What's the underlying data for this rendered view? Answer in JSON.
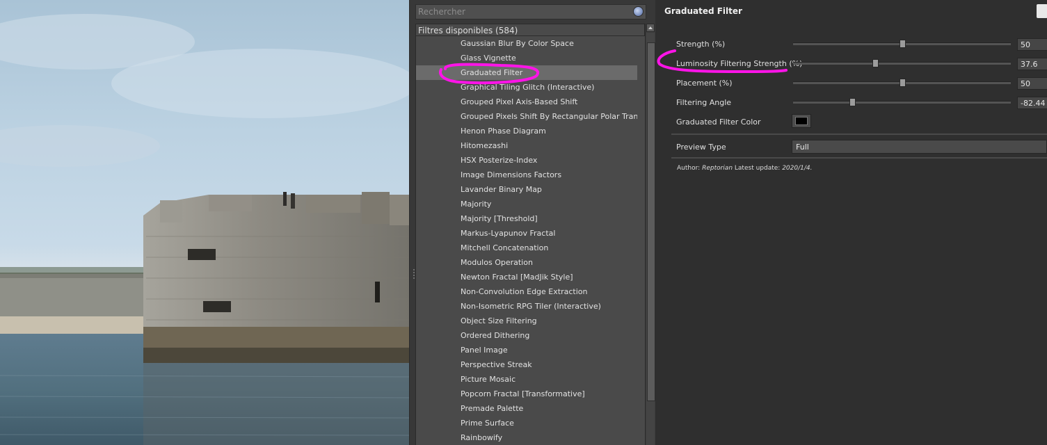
{
  "search": {
    "placeholder": "Rechercher",
    "value": ""
  },
  "filter_list": {
    "header": "Filtres disponibles (584)",
    "items": [
      "Gaussian Blur By Color Space",
      "Glass Vignette",
      "Graduated Filter",
      "Graphical Tiling Glitch (Interactive)",
      "Grouped Pixel Axis-Based Shift",
      "Grouped Pixels Shift By Rectangular Polar Transformation",
      "Henon Phase Diagram",
      "Hitomezashi",
      "HSX Posterize-Index",
      "Image Dimensions Factors",
      "Lavander Binary Map",
      "Majority",
      "Majority [Threshold]",
      "Markus-Lyapunov Fractal",
      "Mitchell Concatenation",
      "Modulos Operation",
      "Newton Fractal [MadJik Style]",
      "Non-Convolution Edge Extraction",
      "Non-Isometric RPG Tiler (Interactive)",
      "Object Size Filtering",
      "Ordered Dithering",
      "Panel Image",
      "Perspective Streak",
      "Picture Mosaic",
      "Popcorn Fractal [Transformative]",
      "Premade Palette",
      "Prime Surface",
      "Rainbowify"
    ],
    "selected": "Graduated Filter"
  },
  "settings": {
    "title": "Graduated Filter",
    "params": [
      {
        "label": "Strength (%)",
        "value": "50",
        "fraction": 0.5
      },
      {
        "label": "Luminosity Filtering Strength (%)",
        "value": "37.6",
        "fraction": 0.376
      },
      {
        "label": "Placement (%)",
        "value": "50",
        "fraction": 0.5
      },
      {
        "label": "Filtering Angle",
        "value": "-82.44",
        "fraction": 0.271
      }
    ],
    "color_label": "Graduated Filter Color",
    "color_value": "#000000",
    "preview_type_label": "Preview Type",
    "preview_type_value": "Full",
    "author_prefix": "Author:",
    "author_name": "Reptorian",
    "update_prefix": "Latest update:",
    "update_date": "2020/1/4."
  },
  "colors": {
    "annotation": "#ff14e8",
    "selected_row": "#6b6b6b"
  }
}
